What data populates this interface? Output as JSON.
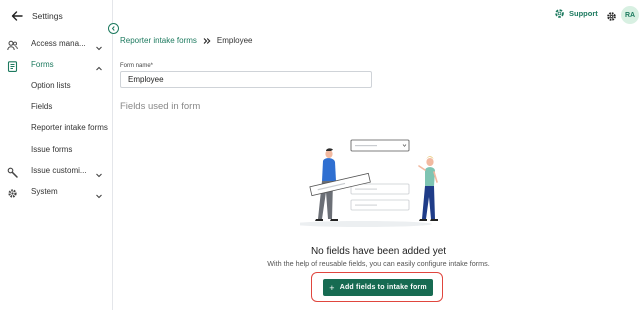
{
  "sidebar": {
    "header_title": "Settings",
    "items": [
      {
        "label": "Access mana...",
        "icon": "users-icon",
        "expanded": false
      },
      {
        "label": "Forms",
        "icon": "forms-icon",
        "expanded": true,
        "active": true,
        "children": [
          "Option lists",
          "Fields",
          "Reporter intake forms",
          "Issue forms"
        ]
      },
      {
        "label": "Issue customi...",
        "icon": "wrench-icon",
        "expanded": false
      },
      {
        "label": "System",
        "icon": "gear-icon",
        "expanded": false
      }
    ]
  },
  "topbar": {
    "support_label": "Support",
    "avatar_initials": "RA"
  },
  "breadcrumb": {
    "parent": "Reporter intake forms",
    "current": "Employee"
  },
  "form": {
    "name_label": "Form name*",
    "name_value": "Employee",
    "section_title": "Fields used in form"
  },
  "empty_state": {
    "title": "No fields have been added yet",
    "subtitle": "With the help of reusable fields, you can easily configure intake forms.",
    "button_label": "Add fields to intake form"
  },
  "colors": {
    "accent": "#1d7a5f",
    "button": "#176b52",
    "highlight": "#e0463e"
  }
}
